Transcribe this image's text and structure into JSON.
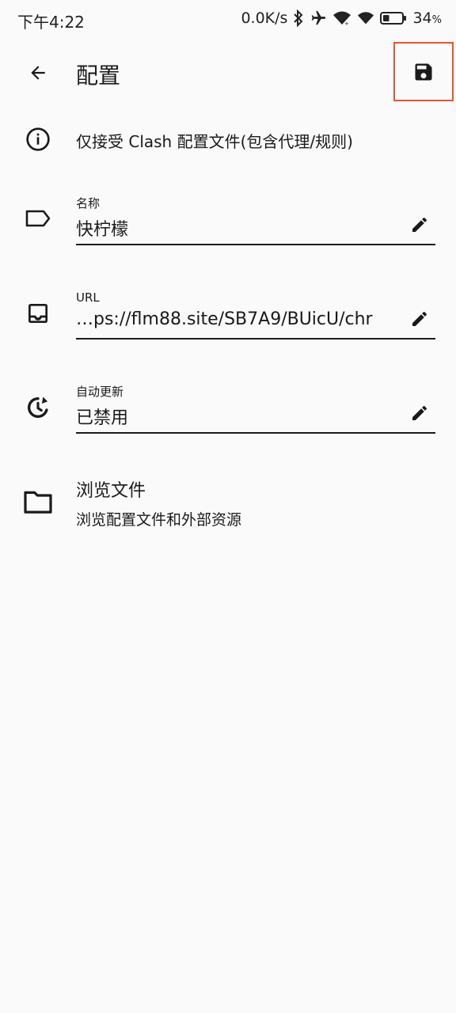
{
  "status_bar": {
    "time": "下午4:22",
    "network_speed": "0.0K/s",
    "battery_value": "34",
    "battery_unit": "%",
    "battery_level": 0.34,
    "icons": [
      "bluetooth-icon",
      "airplane-icon",
      "wifi-icon",
      "wifi-icon",
      "battery-icon"
    ]
  },
  "app_bar": {
    "title": "配置",
    "back_icon": "arrow-left-icon",
    "save_icon": "floppy-disk-icon",
    "highlight_color": "#e8542f"
  },
  "notice": {
    "icon": "info-icon",
    "text": "仅接受 Clash 配置文件(包含代理/规则)"
  },
  "fields": {
    "name": {
      "icon": "label-tag-icon",
      "label": "名称",
      "value": "快柠檬"
    },
    "url": {
      "icon": "inbox-tray-icon",
      "label": "URL",
      "value": "…ps://flm88.site/SB7A9/BUicU/chr"
    },
    "auto_update": {
      "icon": "clock-refresh-icon",
      "label": "自动更新",
      "value": "已禁用"
    }
  },
  "browse": {
    "icon": "folder-icon",
    "title": "浏览文件",
    "subtitle": "浏览配置文件和外部资源"
  }
}
